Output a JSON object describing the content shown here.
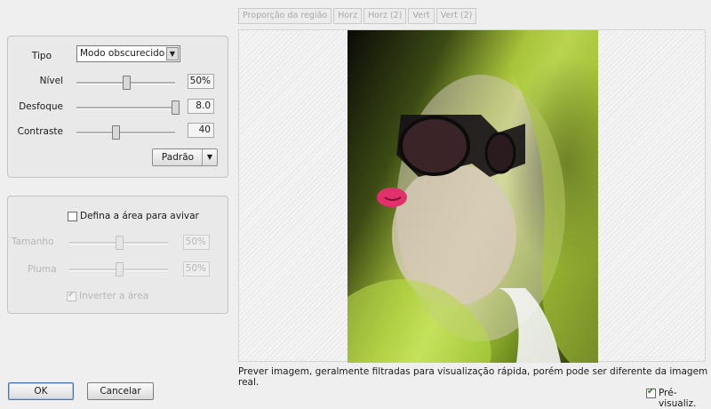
{
  "tabs": [
    "Proporção da região",
    "Horz",
    "Horz (2)",
    "Vert",
    "Vert (2)"
  ],
  "settings": {
    "tipo_label": "Tipo",
    "tipo_value": "Modo obscurecido",
    "nivel_label": "Nível",
    "nivel_value": "50%",
    "nivel_level": 0.5,
    "desfoque_label": "Desfoque",
    "desfoque_value": "8.0",
    "desfoque_level": 1.0,
    "contraste_label": "Contraste",
    "contraste_value": "40",
    "contraste_level": 0.4,
    "default_button": "Padrão"
  },
  "sharpen": {
    "define_area_label": "Defina a área para avivar",
    "define_area_checked": false,
    "tamanho_label": "Tamanho",
    "tamanho_value": "50%",
    "tamanho_level": 0.5,
    "pluma_label": "Pluma",
    "pluma_value": "50%",
    "pluma_level": 0.5,
    "inverter_label": "Inverter a área",
    "inverter_checked": true
  },
  "preview": {
    "caption": "Prever imagem, geralmente filtradas para visualização rápida, porém pode ser diferente da imagem real."
  },
  "footer": {
    "ok_label": "OK",
    "cancel_label": "Cancelar",
    "preview_toggle_label": "Pré-visualiz.",
    "preview_toggle_checked": true
  },
  "icons": {
    "dropdown": "chevron-down-icon",
    "check": "check-icon"
  }
}
